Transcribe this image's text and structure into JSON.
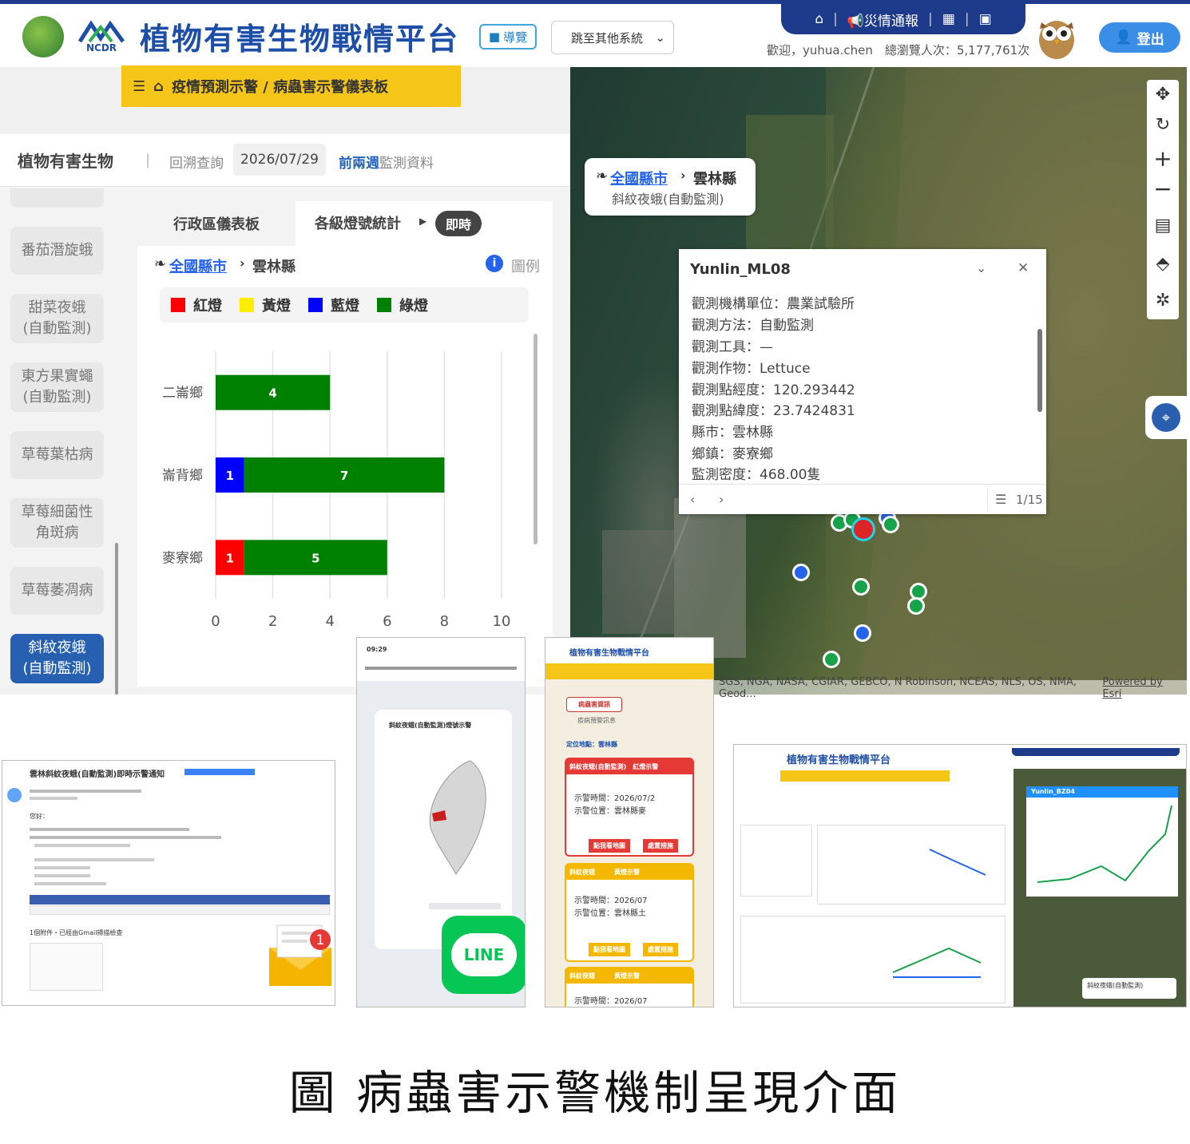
{
  "header": {
    "site_title": "植物有害生物戰情平台",
    "guide_label": "導覽",
    "system_select": "跳至其他系統",
    "nav": {
      "home_icon": "home-icon",
      "alert_label": "災情通報",
      "apps_icon": "grid-icon",
      "screen_icon": "monitor-icon"
    },
    "welcome_text": "歡迎，yuhua.chen　總瀏覽人次：5,177,761次",
    "logout_label": "登出"
  },
  "banner": {
    "menu_icon": "menu-icon",
    "home_icon": "home-icon",
    "path": "疫情預測示警 / 病蟲害示警儀表板"
  },
  "query": {
    "pest_heading": "植物有害生物",
    "back_query_label": "回溯查詢",
    "date": "2026/07/29",
    "week_link": "前兩週",
    "monitor_text": "監測資料"
  },
  "sidebar": {
    "items": [
      {
        "label": "番茄潛旋蛾"
      },
      {
        "label": "甜菜夜蛾\n(自動監測)"
      },
      {
        "label": "東方果實蠅\n(自動監測)"
      },
      {
        "label": "草莓葉枯病"
      },
      {
        "label": "草莓細菌性\n角斑病"
      },
      {
        "label": "草莓萎凋病"
      },
      {
        "label": "斜紋夜蛾\n(自動監測)"
      }
    ]
  },
  "dashboard": {
    "tab_admin": "行政區儀表板",
    "tab_stats": "各級燈號統計",
    "realtime_badge": "即時",
    "breadcrumb_link": "全國縣市",
    "breadcrumb_county": "雲林縣",
    "legend_link": "圖例",
    "lights": [
      {
        "label": "紅燈",
        "color": "#ff0000"
      },
      {
        "label": "黃燈",
        "color": "#ffee00"
      },
      {
        "label": "藍燈",
        "color": "#0000ff"
      },
      {
        "label": "綠燈",
        "color": "#008000"
      }
    ]
  },
  "chart_data": {
    "type": "bar",
    "orientation": "horizontal",
    "stacked": true,
    "categories": [
      "二崙鄉",
      "崙背鄉",
      "麥寮鄉"
    ],
    "series": [
      {
        "name": "紅燈",
        "color": "#ff0000",
        "values": [
          0,
          0,
          1
        ]
      },
      {
        "name": "黃燈",
        "color": "#ffee00",
        "values": [
          0,
          0,
          0
        ]
      },
      {
        "name": "藍燈",
        "color": "#0000ff",
        "values": [
          0,
          1,
          0
        ]
      },
      {
        "name": "綠燈",
        "color": "#008000",
        "values": [
          4,
          7,
          5
        ]
      }
    ],
    "xticks": [
      "0",
      "2",
      "4",
      "6",
      "8",
      "10"
    ],
    "xlim": [
      0,
      10
    ],
    "grid": true
  },
  "map": {
    "breadcrumb_link": "全國縣市",
    "breadcrumb_county": "雲林縣",
    "breadcrumb_pest": "斜紋夜蛾(自動監測)",
    "attribution_left": "SGS, NGA, NASA, CGIAR, GEBCO, N Robinson, NCEAS, NLS, OS, NMA, Geod...",
    "attribution_right": "Powered by Esri",
    "tools": [
      "move-icon",
      "rotate-icon",
      "zoom-in-icon",
      "zoom-out-icon",
      "layers-icon",
      "compass-icon",
      "pest-filter-icon"
    ],
    "popup": {
      "title": "Yunlin_ML08",
      "lines": [
        "觀測機構單位：農業試驗所",
        "觀測方法：自動監測",
        "觀測工具：—",
        "觀測作物：Lettuce",
        "觀測點經度：120.293442",
        "觀測點緯度：23.7424831",
        "縣市：雲林縣",
        "鄉鎮：麥寮鄉",
        "監測密度：468.00隻"
      ],
      "page": "1/15"
    }
  },
  "collage": {
    "email": {
      "subject": "雲林斜紋夜蛾(自動監測)即時示警通知",
      "greeting": "您好：",
      "attachment_note": "1個附件・已經由Gmail掃描檢查"
    },
    "phone": {
      "time": "09:29",
      "chat_title": "斜紋夜蛾(自動監測)燈號示警",
      "line_logo": "LINE"
    },
    "mobile": {
      "title": "植物有害生物戰情平台",
      "tab_alert": "病蟲害資訊",
      "tab_forecast": "疫病預警訊息",
      "location": "定位地點：雲林縣",
      "card1_title": "斜紋夜蛾(自動監測)　紅燈示警",
      "card1_time": "示警時間：2026/07/2",
      "card1_place": "示警位置：雲林縣麥",
      "card2_title": "斜紋夜蛾　　　黃燈示警",
      "card2_time": "示警時間：2026/07",
      "card2_place": "示警位置：雲林縣土",
      "card3_title": "斜紋夜蛾　　　黃燈示警",
      "card3_time": "示警時間：2026/07",
      "btn_map": "點我看地圖",
      "btn_measure": "處置措施"
    },
    "desktop": {
      "title": "植物有害生物戰情平台",
      "popup_title": "Yunlin_BZ04",
      "pest_label": "斜紋夜蛾(自動監測)"
    }
  },
  "caption": "圖 病蟲害示警機制呈現介面"
}
